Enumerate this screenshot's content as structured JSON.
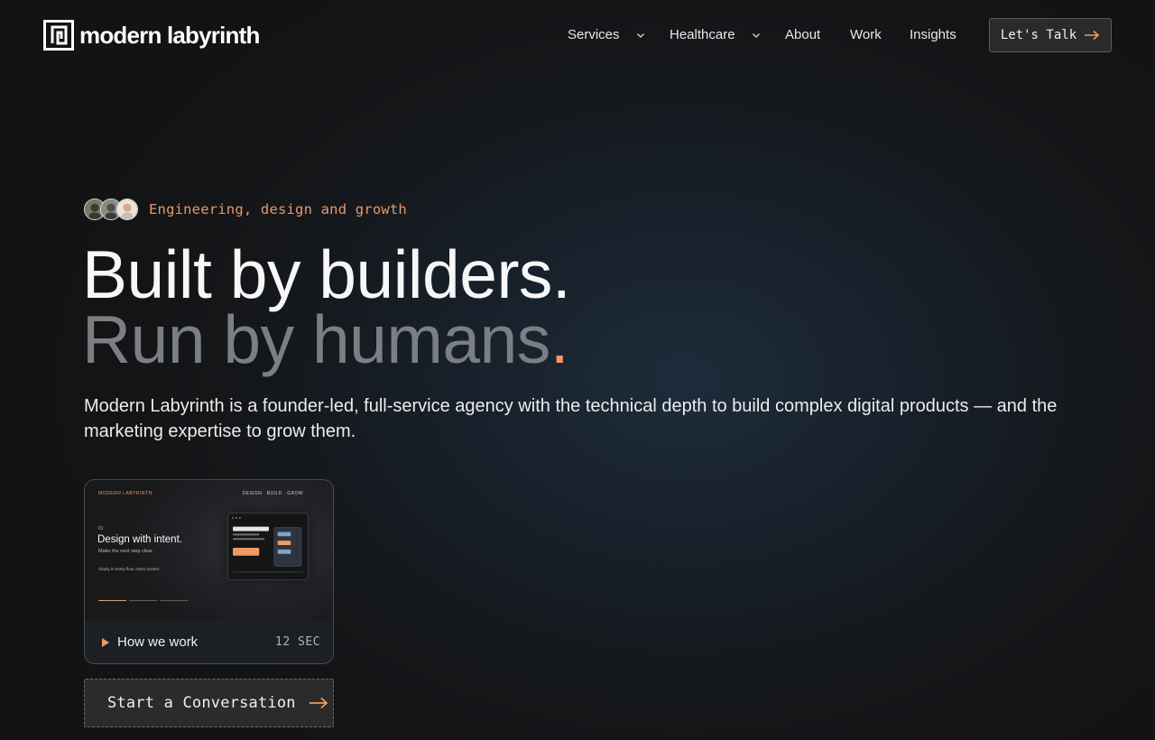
{
  "brand": {
    "name": "modern labyrinth"
  },
  "nav": {
    "items": [
      {
        "label": "Services",
        "has_dropdown": true
      },
      {
        "label": "Healthcare",
        "has_dropdown": true
      },
      {
        "label": "About",
        "has_dropdown": false
      },
      {
        "label": "Work",
        "has_dropdown": false
      },
      {
        "label": "Insights",
        "has_dropdown": false
      }
    ],
    "cta_label": "Let's Talk"
  },
  "hero": {
    "eyebrow": "Engineering, design and growth",
    "headline_line1": "Built by builders.",
    "headline_line2": "Run by humans",
    "headline_line2_punct": ".",
    "description": "Modern Labyrinth is a founder-led, full-service agency with the technical depth to build complex digital products — and the marketing expertise to grow them."
  },
  "video": {
    "thumbnail": {
      "brand": "MODERN LABYRINTH",
      "nav_text": "DESIGN · BUILD · GROW",
      "small": "01",
      "heading": "Design with intent.",
      "subheading": "Make the next step clear.",
      "line": "Clarity in every flow, every screen."
    },
    "label": "How we work",
    "duration": "12 SEC"
  },
  "cta_main": {
    "label": "Start a Conversation"
  },
  "colors": {
    "accent": "#ef9a62",
    "eyebrow": "#e29a6c",
    "background": "#141619",
    "muted_headline": "#7b7f84"
  },
  "icons": [
    "logo-mark-icon",
    "chevron-down-icon",
    "arrow-right-icon",
    "play-icon"
  ]
}
